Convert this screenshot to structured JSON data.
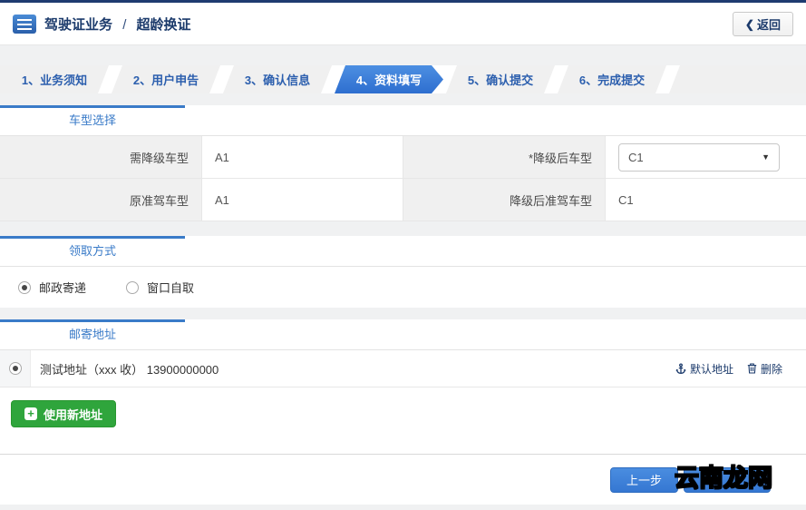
{
  "page": {
    "title_primary": "驾驶证业务",
    "title_separator": "/",
    "title_secondary": "超龄换证",
    "back_button_label": "返回"
  },
  "icons": {
    "header": "list-icon",
    "back": "❮",
    "select_arrow": "▼",
    "add": "+",
    "default_address": "anchor-icon",
    "delete": "trash-icon"
  },
  "steps": [
    {
      "label": "1、业务须知",
      "active": false
    },
    {
      "label": "2、用户申告",
      "active": false
    },
    {
      "label": "3、确认信息",
      "active": false
    },
    {
      "label": "4、资料填写",
      "active": true
    },
    {
      "label": "5、确认提交",
      "active": false
    },
    {
      "label": "6、完成提交",
      "active": false
    }
  ],
  "sections": {
    "vehicle": {
      "title": "车型选择",
      "fields": [
        {
          "label": "需降级车型",
          "value": "A1",
          "type": "text"
        },
        {
          "label": "*降级后车型",
          "value": "C1",
          "type": "select"
        },
        {
          "label": "原准驾车型",
          "value": "A1",
          "type": "text"
        },
        {
          "label": "降级后准驾车型",
          "value": "C1",
          "type": "text"
        }
      ]
    },
    "pickup": {
      "title": "领取方式",
      "options": [
        {
          "label": "邮政寄递",
          "selected": true
        },
        {
          "label": "窗口自取",
          "selected": false
        }
      ]
    },
    "mailing": {
      "title": "邮寄地址",
      "address": {
        "text": "测试地址（xxx 收）  13900000000",
        "selected": true
      },
      "default_link": "默认地址",
      "delete_link": "删除",
      "new_address_button": "使用新地址"
    }
  },
  "footer": {
    "prev_button": "上一步",
    "watermark_part1": "云南",
    "watermark_part2": "龙网"
  },
  "colors": {
    "top_border": "#1e3b70",
    "navy_text": "#1b3a6b",
    "tab_active": "#3b7ad6",
    "section_accent": "#3a7bc8",
    "green_button": "#2fa53c",
    "blue_button": "#3d83d9",
    "watermark_orange": "#e8772a"
  }
}
